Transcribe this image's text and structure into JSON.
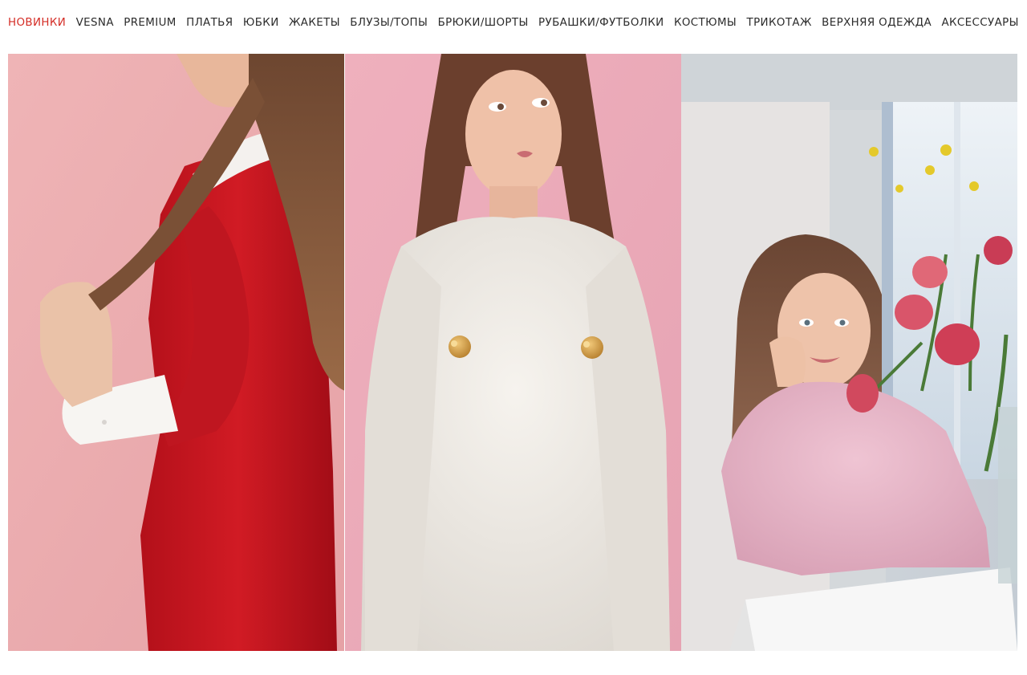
{
  "nav": {
    "items": [
      {
        "label": "НОВИНКИ",
        "active": true
      },
      {
        "label": "VESNA"
      },
      {
        "label": "PREMIUM"
      },
      {
        "label": "ПЛАТЬЯ"
      },
      {
        "label": "ЮБКИ"
      },
      {
        "label": "ЖАКЕТЫ"
      },
      {
        "label": "БЛУЗЫ/ТОПЫ"
      },
      {
        "label": "БРЮКИ/ШОРТЫ"
      },
      {
        "label": "РУБАШКИ/ФУТБОЛКИ"
      },
      {
        "label": "КОСТЮМЫ"
      },
      {
        "label": "ТРИКОТАЖ"
      },
      {
        "label": "ВЕРХНЯЯ ОДЕЖДА"
      },
      {
        "label": "АКСЕССУАРЫ"
      }
    ],
    "active_color": "#d42d26",
    "text_color": "#2b2b2b"
  },
  "gallery": {
    "tiles": [
      {
        "subject": "model in red satin dress with white collar and cuffs on pink background"
      },
      {
        "subject": "model in white fluffy mohair sweater with gold flower buttons on pink background"
      },
      {
        "subject": "model in pink fluffy sweater at white table with pink tulips"
      }
    ]
  }
}
